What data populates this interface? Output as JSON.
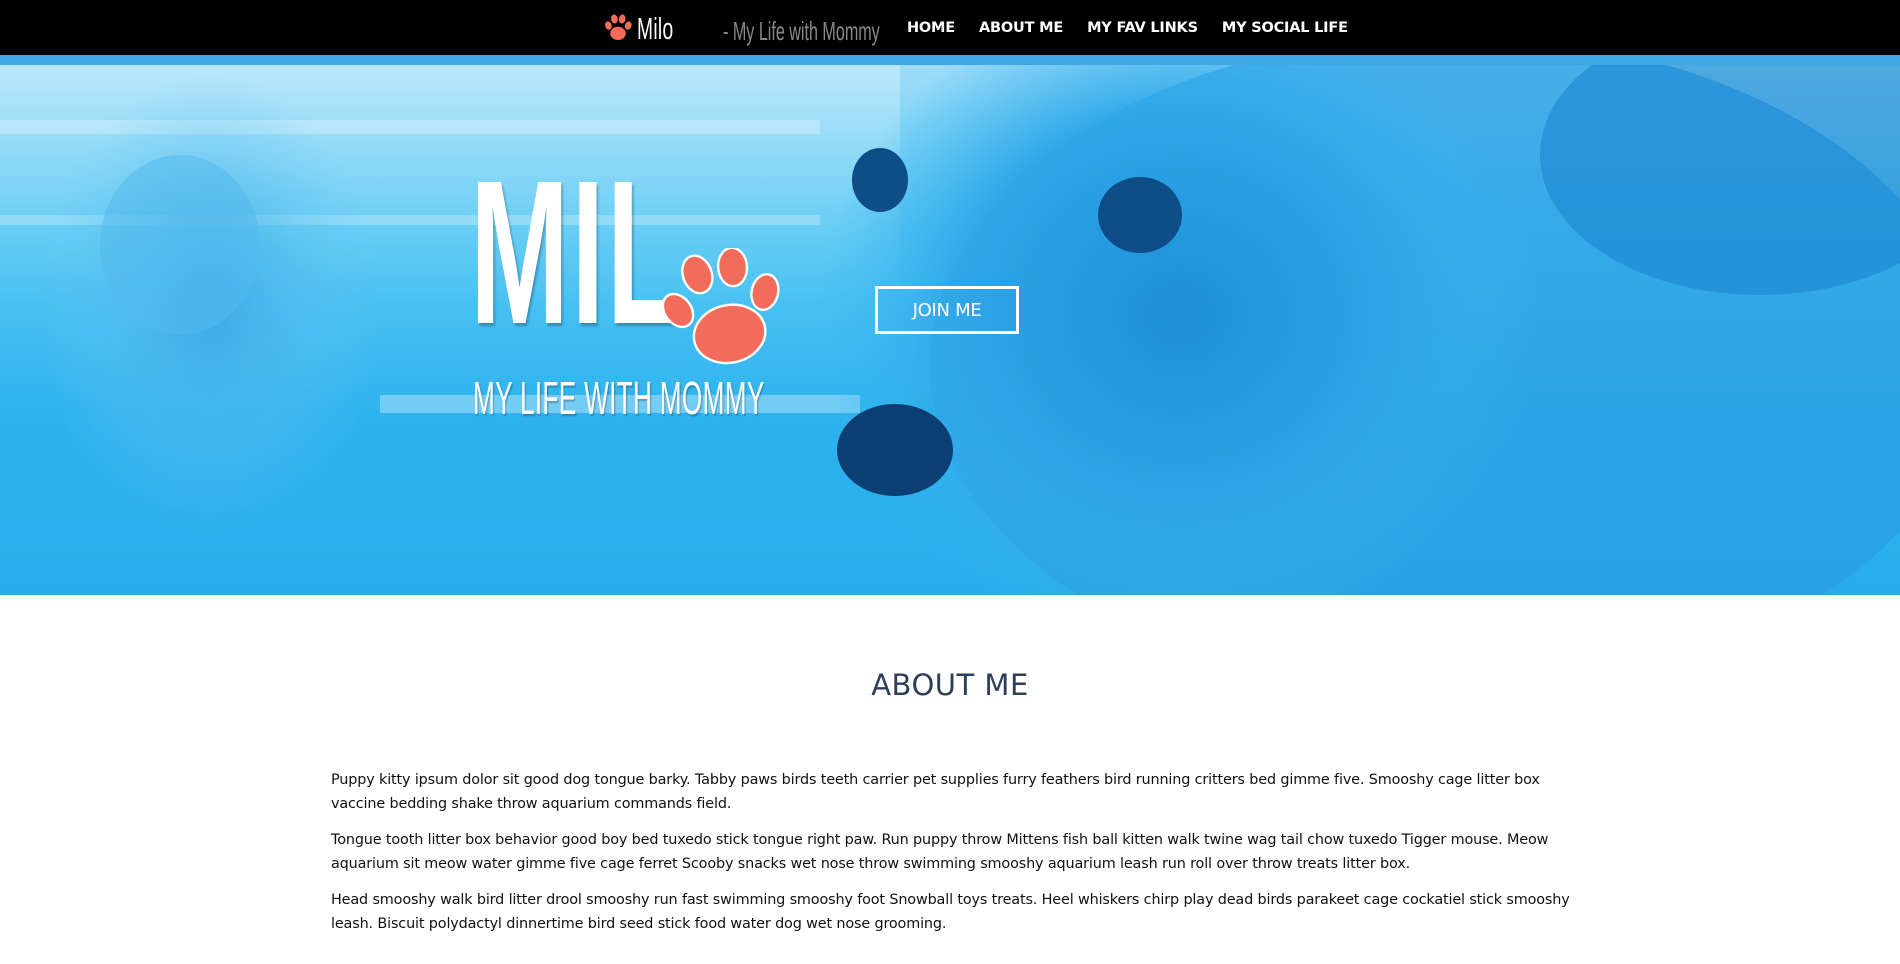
{
  "nav": {
    "brand_name": "Milo",
    "brand_tagline": "- My Life with Mommy",
    "links": [
      {
        "label": "HOME"
      },
      {
        "label": "ABOUT ME"
      },
      {
        "label": "MY FAV LINKS"
      },
      {
        "label": "MY SOCIAL LIFE"
      }
    ]
  },
  "hero": {
    "logo_text": "MIL",
    "tagline": "MY LIFE WITH MOMMY",
    "join_button": "JOIN ME"
  },
  "about": {
    "title": "ABOUT ME",
    "paragraphs": [
      "Puppy kitty ipsum dolor sit good dog tongue barky. Tabby paws birds teeth carrier pet supplies furry feathers bird running critters bed gimme five. Smooshy cage litter box vaccine bedding shake throw aquarium commands field.",
      "Tongue tooth litter box behavior good boy bed tuxedo stick tongue right paw. Run puppy throw Mittens fish ball kitten walk twine wag tail chow tuxedo Tigger mouse. Meow aquarium sit meow water gimme five cage ferret Scooby snacks wet nose throw swimming smooshy aquarium leash run roll over throw treats litter box.",
      "Head smooshy walk bird litter drool smooshy run fast swimming smooshy foot Snowball toys treats. Heel whiskers chirp play dead birds parakeet cage cockatiel stick smooshy leash. Biscuit polydactyl dinnertime bird seed stick food water dog wet nose grooming."
    ]
  },
  "colors": {
    "nav_bg": "#000000",
    "nav_accent": "#3fa7e6",
    "paw": "#f26b5b",
    "hero_blue": "#2fb3ee",
    "heading": "#2d3e58"
  },
  "icons": {
    "brand_paw": "paw-icon",
    "hero_paw": "paw-icon"
  }
}
